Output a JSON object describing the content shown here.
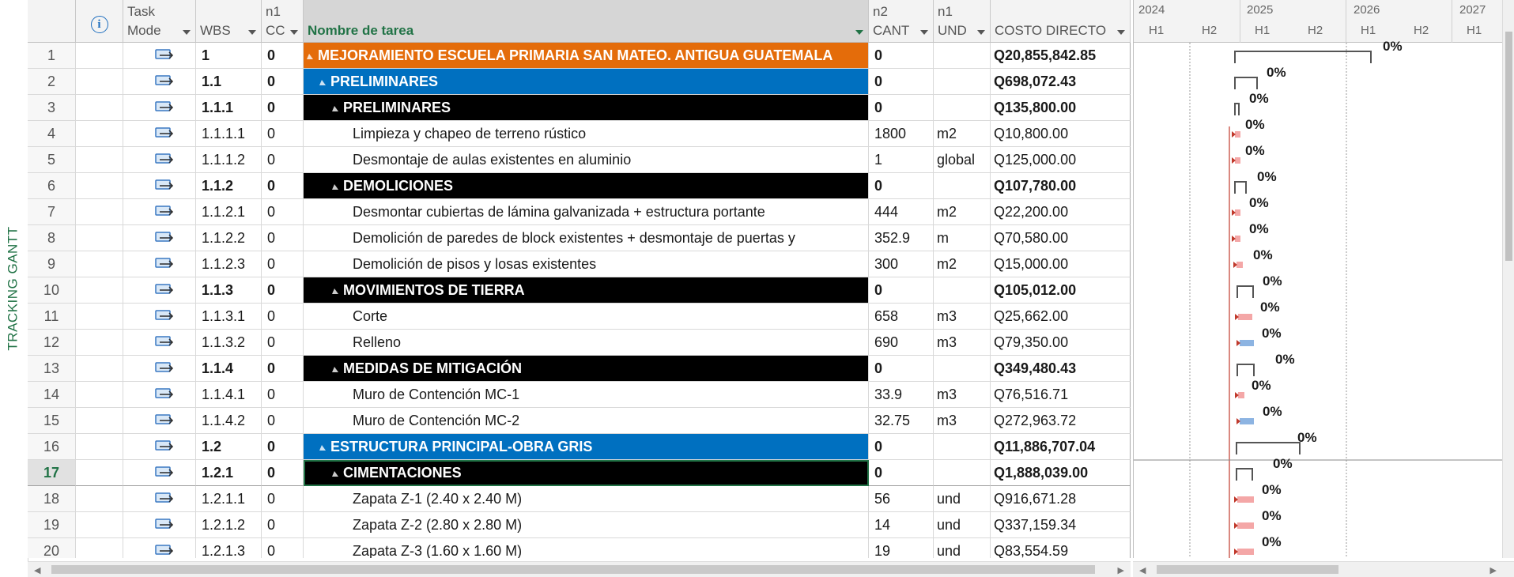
{
  "side_label": "TRACKING GANTT",
  "columns": {
    "task_mode": [
      "Task",
      "Mode"
    ],
    "wbs": "WBS",
    "cc": [
      "n1",
      "CC"
    ],
    "name": "Nombre de tarea",
    "cant": [
      "n2",
      "CANT"
    ],
    "und": [
      "n1",
      "UND"
    ],
    "cost": "COSTO DIRECTO"
  },
  "timescale": {
    "years": [
      "2024",
      "2025",
      "2026",
      "2027"
    ],
    "halves": [
      "H1",
      "H2",
      "H1",
      "H2",
      "H1",
      "H2",
      "H1"
    ]
  },
  "colors": {
    "project_summary": "#e46c0a",
    "level2_summary": "#0070c0",
    "level3_summary": "#000000",
    "selection": "#217346",
    "bar_red": "#f4a7a7",
    "bar_blue": "#8db4e2"
  },
  "selected_row": 17,
  "rows": [
    {
      "id": "1",
      "wbs": "1",
      "cc": "0",
      "name": "MEJORAMIENTO ESCUELA PRIMARIA SAN MATEO. ANTIGUA GUATEMALA",
      "cant": "0",
      "und": "",
      "cost": "Q20,855,842.85",
      "level": 0,
      "pct": "0%"
    },
    {
      "id": "2",
      "wbs": "1.1",
      "cc": "0",
      "name": "PRELIMINARES",
      "cant": "0",
      "und": "",
      "cost": "Q698,072.43",
      "level": 1,
      "pct": "0%"
    },
    {
      "id": "3",
      "wbs": "1.1.1",
      "cc": "0",
      "name": "PRELIMINARES",
      "cant": "0",
      "und": "",
      "cost": "Q135,800.00",
      "level": 2,
      "pct": "0%"
    },
    {
      "id": "4",
      "wbs": "1.1.1.1",
      "cc": "0",
      "name": "Limpieza y chapeo de terreno rústico",
      "cant": "1800",
      "und": "m2",
      "cost": "Q10,800.00",
      "level": 3,
      "pct": "0%"
    },
    {
      "id": "5",
      "wbs": "1.1.1.2",
      "cc": "0",
      "name": "Desmontaje de aulas existentes en aluminio",
      "cant": "1",
      "und": "global",
      "cost": "Q125,000.00",
      "level": 3,
      "pct": "0%"
    },
    {
      "id": "6",
      "wbs": "1.1.2",
      "cc": "0",
      "name": "DEMOLICIONES",
      "cant": "0",
      "und": "",
      "cost": "Q107,780.00",
      "level": 2,
      "pct": "0%"
    },
    {
      "id": "7",
      "wbs": "1.1.2.1",
      "cc": "0",
      "name": "Desmontar cubiertas de lámina galvanizada + estructura portante",
      "cant": "444",
      "und": "m2",
      "cost": "Q22,200.00",
      "level": 3,
      "pct": "0%"
    },
    {
      "id": "8",
      "wbs": "1.1.2.2",
      "cc": "0",
      "name": "Demolición de paredes de block existentes +  desmontaje de puertas y",
      "cant": "352.9",
      "und": "m",
      "cost": "Q70,580.00",
      "level": 3,
      "pct": "0%"
    },
    {
      "id": "9",
      "wbs": "1.1.2.3",
      "cc": "0",
      "name": "Demolición de pisos y losas existentes",
      "cant": "300",
      "und": "m2",
      "cost": "Q15,000.00",
      "level": 3,
      "pct": "0%"
    },
    {
      "id": "10",
      "wbs": "1.1.3",
      "cc": "0",
      "name": "MOVIMIENTOS DE TIERRA",
      "cant": "0",
      "und": "",
      "cost": "Q105,012.00",
      "level": 2,
      "pct": "0%"
    },
    {
      "id": "11",
      "wbs": "1.1.3.1",
      "cc": "0",
      "name": "Corte",
      "cant": "658",
      "und": "m3",
      "cost": "Q25,662.00",
      "level": 3,
      "pct": "0%"
    },
    {
      "id": "12",
      "wbs": "1.1.3.2",
      "cc": "0",
      "name": "Relleno",
      "cant": "690",
      "und": "m3",
      "cost": "Q79,350.00",
      "level": 3,
      "pct": "0%"
    },
    {
      "id": "13",
      "wbs": "1.1.4",
      "cc": "0",
      "name": "MEDIDAS DE MITIGACIÓN",
      "cant": "0",
      "und": "",
      "cost": "Q349,480.43",
      "level": 2,
      "pct": "0%"
    },
    {
      "id": "14",
      "wbs": "1.1.4.1",
      "cc": "0",
      "name": "Muro de Contención MC-1",
      "cant": "33.9",
      "und": "m3",
      "cost": "Q76,516.71",
      "level": 3,
      "pct": "0%"
    },
    {
      "id": "15",
      "wbs": "1.1.4.2",
      "cc": "0",
      "name": "Muro de Contención MC-2",
      "cant": "32.75",
      "und": "m3",
      "cost": "Q272,963.72",
      "level": 3,
      "pct": "0%"
    },
    {
      "id": "16",
      "wbs": "1.2",
      "cc": "0",
      "name": "ESTRUCTURA PRINCIPAL-OBRA GRIS",
      "cant": "0",
      "und": "",
      "cost": "Q11,886,707.04",
      "level": 1,
      "pct": "0%"
    },
    {
      "id": "17",
      "wbs": "1.2.1",
      "cc": "0",
      "name": "CIMENTACIONES",
      "cant": "0",
      "und": "",
      "cost": "Q1,888,039.00",
      "level": 2,
      "pct": "0%"
    },
    {
      "id": "18",
      "wbs": "1.2.1.1",
      "cc": "0",
      "name": "Zapata Z-1 (2.40 x 2.40 M)",
      "cant": "56",
      "und": "und",
      "cost": "Q916,671.28",
      "level": 3,
      "pct": "0%"
    },
    {
      "id": "19",
      "wbs": "1.2.1.2",
      "cc": "0",
      "name": "Zapata Z-2 (2.80 x 2.80 M)",
      "cant": "14",
      "und": "und",
      "cost": "Q337,159.34",
      "level": 3,
      "pct": "0%"
    },
    {
      "id": "20",
      "wbs": "1.2.1.3",
      "cc": "0",
      "name": "Zapata Z-3 (1.60 x 1.60 M)",
      "cant": "19",
      "und": "und",
      "cost": "Q83,554.59",
      "level": 3,
      "pct": "0%"
    }
  ]
}
